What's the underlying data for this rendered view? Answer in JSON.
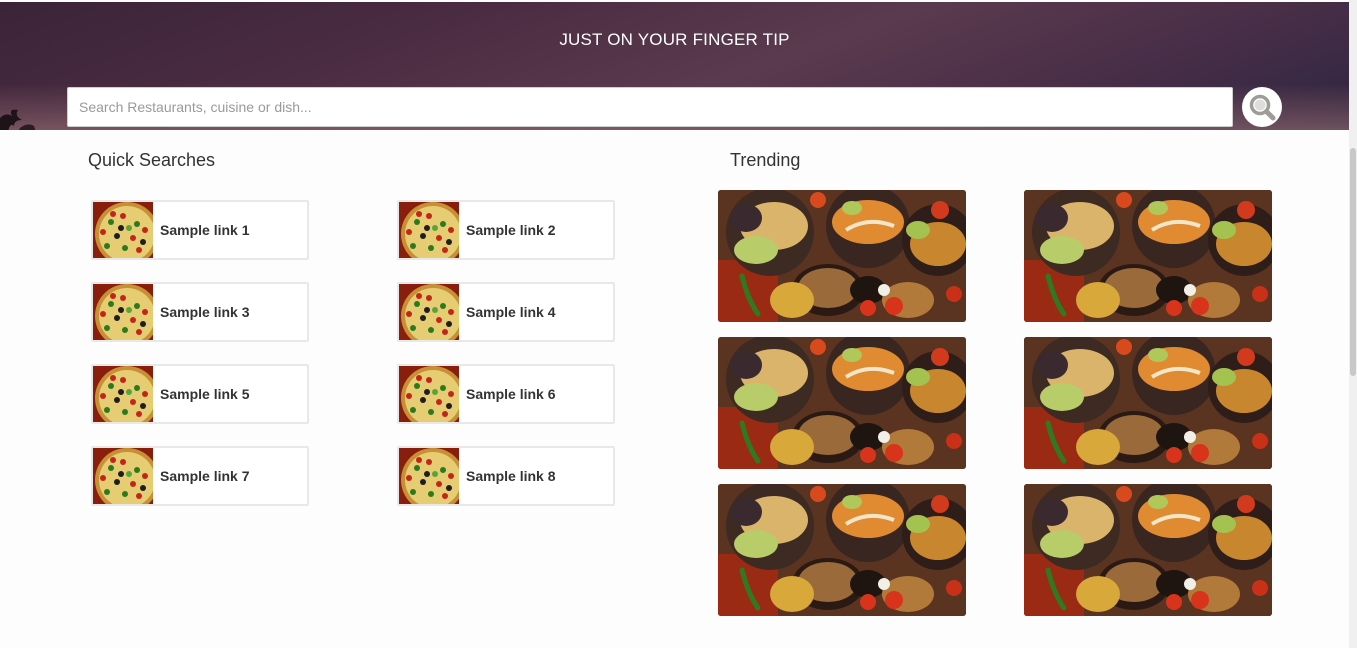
{
  "hero": {
    "title": "JUST ON YOUR FINGER TIP"
  },
  "search": {
    "placeholder": "Search Restaurants, cuisine or dish...",
    "button_icon": "search-icon"
  },
  "quick_searches": {
    "title": "Quick Searches",
    "items": [
      {
        "label": "Sample link 1"
      },
      {
        "label": "Sample link 2"
      },
      {
        "label": "Sample link 3"
      },
      {
        "label": "Sample link 4"
      },
      {
        "label": "Sample link 5"
      },
      {
        "label": "Sample link 6"
      },
      {
        "label": "Sample link 7"
      },
      {
        "label": "Sample link 8"
      }
    ]
  },
  "trending": {
    "title": "Trending",
    "count": 6
  },
  "colors": {
    "header_bg": "#4b2c42",
    "page_bg": "#fdfdfd",
    "text": "#333333"
  }
}
